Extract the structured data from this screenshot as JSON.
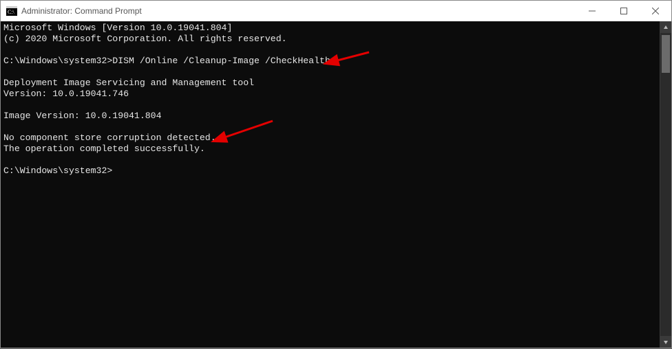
{
  "window": {
    "title": "Administrator: Command Prompt"
  },
  "console": {
    "lines": [
      "Microsoft Windows [Version 10.0.19041.804]",
      "(c) 2020 Microsoft Corporation. All rights reserved.",
      "",
      "C:\\Windows\\system32>DISM /Online /Cleanup-Image /CheckHealth",
      "",
      "Deployment Image Servicing and Management tool",
      "Version: 10.0.19041.746",
      "",
      "Image Version: 10.0.19041.804",
      "",
      "No component store corruption detected.",
      "The operation completed successfully.",
      "",
      "C:\\Windows\\system32>"
    ],
    "prompt_path": "C:\\Windows\\system32>",
    "command": "DISM /Online /Cleanup-Image /CheckHealth"
  }
}
